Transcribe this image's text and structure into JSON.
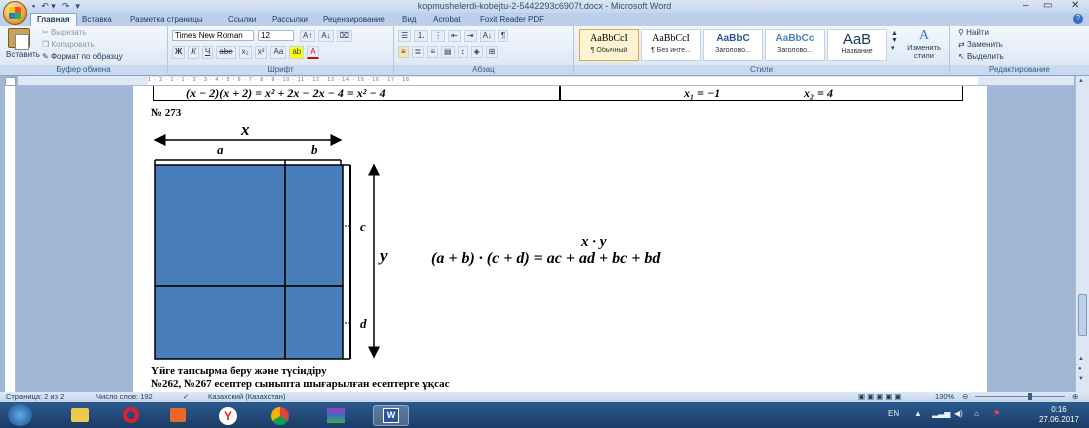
{
  "window": {
    "title": "kopmushelerdi-kobejtu-2-5442293c6907f.docx - Microsoft Word",
    "qat_save": "▪",
    "qat_undo": "↶ ▾",
    "qat_redo": "↷",
    "qat_more": "▾",
    "minimize": "–",
    "maximize": "▭",
    "close": "✕"
  },
  "ribbon_tabs": [
    "Главная",
    "Вставка",
    "Разметка страницы",
    "Ссылки",
    "Рассылки",
    "Рецензирование",
    "Вид",
    "Acrobat",
    "Foxit Reader PDF"
  ],
  "clipboard": {
    "paste": "Вставить",
    "cut": "Вырезать",
    "copy": "Копировать",
    "format_painter": "Формат по образцу",
    "label": "Буфер обмена"
  },
  "font": {
    "name": "Times New Roman",
    "size": "12",
    "grow": "A↑",
    "shrink": "A↓",
    "clear": "⌧",
    "bold": "Ж",
    "italic": "К",
    "underline": "Ч",
    "strike": "abe",
    "subscript": "x₂",
    "superscript": "x²",
    "change_case": "Аа",
    "highlight": "ab",
    "color": "A",
    "label": "Шрифт"
  },
  "paragraph": {
    "bullets": "☰",
    "numbering": "⒈",
    "multilevel": "⋮",
    "dec_indent": "⇤",
    "inc_indent": "⇥",
    "sort": "A↓",
    "show_marks": "¶",
    "align_left": "≡",
    "center": "≣",
    "align_right": "≡",
    "justify": "▤",
    "line_spacing": "↕",
    "shading": "◈",
    "borders": "⊞",
    "label": "Абзац"
  },
  "styles": {
    "items": [
      {
        "sample": "AaBbCcI",
        "name": "¶ Обычный"
      },
      {
        "sample": "AaBbCcI",
        "name": "¶ Без инте..."
      },
      {
        "sample": "AaBbC",
        "name": "Заголово..."
      },
      {
        "sample": "AaBbCc",
        "name": "Заголово..."
      },
      {
        "sample": "AaB",
        "name": "Название"
      }
    ],
    "change": "Изменить стили",
    "label": "Стили"
  },
  "editing": {
    "find": "Найти",
    "replace": "Заменить",
    "select": "Выделить",
    "label": "Редактирование"
  },
  "ruler_text": "1 · 2 · 1 · 1 · 2 · 3 · 4 · 5 · 6 · 7 · 8 · 9 · 10 · 11 · 12 · 13 · 14 · 15 · 16 · 17 · 18",
  "document": {
    "table_left": "(x − 2)(x + 2) = x² + 2x − 2x − 4 = x² − 4",
    "table_right_x1": "x₁ = −1",
    "table_right_x2": "x₂ = 4",
    "problem_number": "№ 273",
    "diagram": {
      "top_label": "x",
      "top_a": "a",
      "top_b": "b",
      "side_c": "c",
      "side_d": "d",
      "side_y": "y"
    },
    "formula_top": "x · y",
    "formula_main": "(a + b) · (c + d) = ac + ad + bc + bd",
    "homework_title": "Үйге тапсырма беру және түсіндіру",
    "homework_text": "№262, №267 есептер сыныпта шығарылған есептерге ұқсас"
  },
  "status": {
    "page": "Страница: 2 из 2",
    "words": "Число слов: 192",
    "language": "Казахский (Казахстан)",
    "zoom": "130%"
  },
  "taskbar": {
    "lang": "EN",
    "time": "0:16",
    "date": "27.06.2017"
  },
  "colors": {
    "rect_fill": "#4a7ebb",
    "accent": "#1e395b"
  }
}
